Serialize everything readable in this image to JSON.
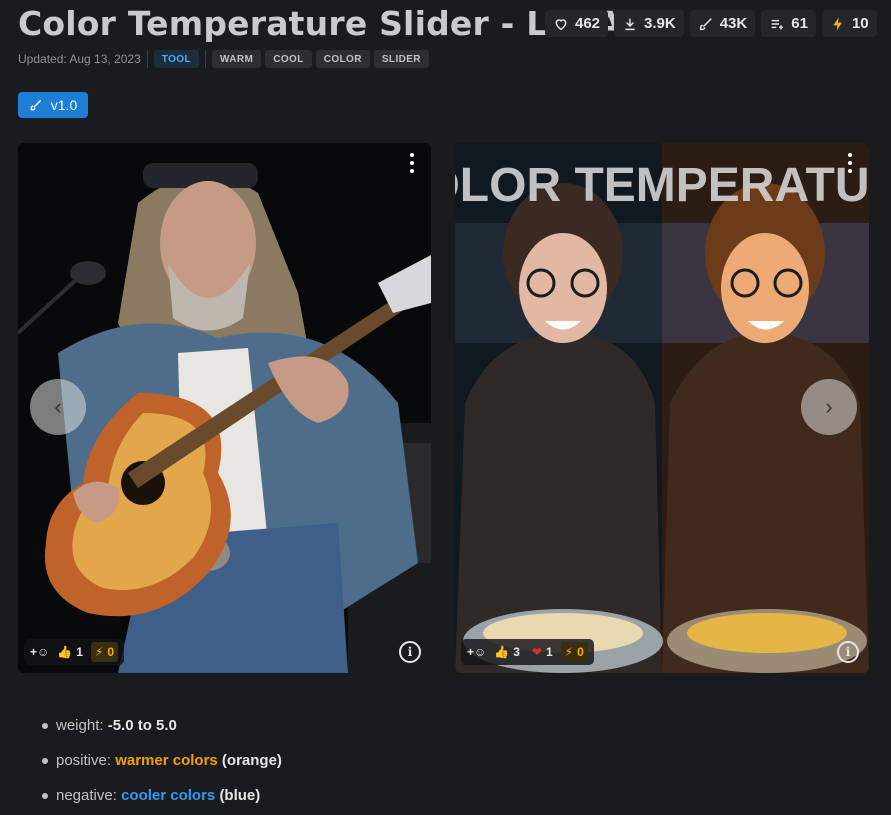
{
  "title": "Color Temperature Slider - LoRA",
  "stats": {
    "likes": "462",
    "downloads": "3.9K",
    "generations": "43K",
    "collected": "61",
    "buzz": "10"
  },
  "updated": "Updated: Aug 13, 2023",
  "tags": [
    "TOOL",
    "WARM",
    "COOL",
    "COLOR",
    "SLIDER"
  ],
  "version": "v1.0",
  "gallery": {
    "card1": {
      "thumbs_count": "1",
      "buzz_count": "0"
    },
    "card2": {
      "overlay_text": "COLOR TEMPERATURE",
      "thumbs_count": "3",
      "heart_count": "1",
      "buzz_count": "0"
    }
  },
  "description": {
    "weight_label": "weight:",
    "weight_value": "-5.0 to 5.0",
    "positive_label": "positive:",
    "positive_value": "warmer colors",
    "positive_note": "(orange)",
    "negative_label": "negative:",
    "negative_value": "cooler colors",
    "negative_note": "(blue)"
  },
  "colors": {
    "accent": "#1c7ed6",
    "warm": "#f59f00",
    "cool": "#339af0"
  }
}
